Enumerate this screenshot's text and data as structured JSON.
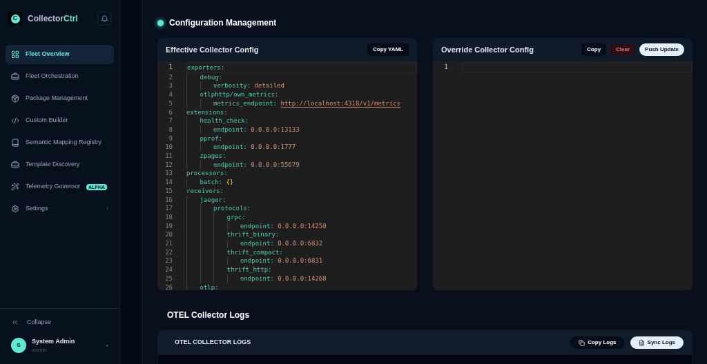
{
  "brand": {
    "name": "Collector",
    "name_accent": "Ctrl",
    "logo_letter": "C"
  },
  "sidebar": {
    "items": [
      {
        "label": "Fleet Overview",
        "selected": true
      },
      {
        "label": "Fleet Orchestration",
        "selected": false
      },
      {
        "label": "Package Management",
        "selected": false
      },
      {
        "label": "Custom Builder",
        "selected": false
      },
      {
        "label": "Semantic Mapping Registry",
        "selected": false
      },
      {
        "label": "Template Discovery",
        "selected": false
      },
      {
        "label": "Telemetry Governor",
        "selected": false,
        "badge": "ALPHA"
      },
      {
        "label": "Settings",
        "selected": false,
        "chevron": "›"
      }
    ],
    "collapse": "Collapse",
    "user": {
      "initial": "S",
      "name": "System Admin",
      "role": "admin",
      "caret": "▾"
    }
  },
  "page_title": "Configuration Management",
  "effective_config": {
    "title": "Effective Collector Config",
    "buttons": [
      {
        "label": "Copy YAML",
        "kind": "dark"
      }
    ],
    "lines": [
      {
        "number": "1",
        "key": "exporters:",
        "children": [
          {
            "number": "2",
            "key": "debug:",
            "children": [
              {
                "number": "3",
                "key": "verbosity:",
                "value": "detailed",
                "kind": "string"
              }
            ]
          },
          {
            "number": "4",
            "key": "otlphttp/own_metrics:",
            "children": [
              {
                "number": "5",
                "key": "metrics_endpoint:",
                "value": "http://localhost:4318/v1/metrics",
                "kind": "link"
              }
            ]
          }
        ]
      },
      {
        "number": "6",
        "key": "extensions:",
        "children": [
          {
            "number": "7",
            "key": "health_check:",
            "children": [
              {
                "number": "8",
                "key": "endpoint:",
                "value": "0.0.0.0:13133",
                "kind": "string"
              }
            ]
          },
          {
            "number": "9",
            "key": "pprof:",
            "children": [
              {
                "number": "10",
                "key": "endpoint:",
                "value": "0.0.0.0:1777",
                "kind": "string"
              }
            ]
          },
          {
            "number": "11",
            "key": "zpages:",
            "children": [
              {
                "number": "12",
                "key": "endpoint:",
                "value": "0.0.0.0:55679",
                "kind": "string"
              }
            ]
          }
        ]
      },
      {
        "number": "13",
        "key": "processors:",
        "children": [
          {
            "number": "14",
            "key": "batch:",
            "value": "{}",
            "kind": "braces"
          }
        ]
      },
      {
        "number": "15",
        "key": "receivers:",
        "children": [
          {
            "number": "16",
            "key": "jaeger:",
            "children": [
              {
                "number": "17",
                "key": "protocols:",
                "children": [
                  {
                    "number": "18",
                    "key": "grpc:",
                    "children": [
                      {
                        "number": "19",
                        "key": "endpoint:",
                        "value": "0.0.0.0:14250",
                        "kind": "string"
                      }
                    ]
                  },
                  {
                    "number": "20",
                    "key": "thrift_binary:",
                    "children": [
                      {
                        "number": "21",
                        "key": "endpoint:",
                        "value": "0.0.0.0:6832",
                        "kind": "string"
                      }
                    ]
                  },
                  {
                    "number": "22",
                    "key": "thrift_compact:",
                    "children": [
                      {
                        "number": "23",
                        "key": "endpoint:",
                        "value": "0.0.0.0:6831",
                        "kind": "string"
                      }
                    ]
                  },
                  {
                    "number": "24",
                    "key": "thrift_http:",
                    "children": [
                      {
                        "number": "25",
                        "key": "endpoint:",
                        "value": "0.0.0.0:14268",
                        "kind": "string"
                      }
                    ]
                  }
                ]
              }
            ]
          },
          {
            "number": "26",
            "key": "otlp:"
          }
        ]
      }
    ]
  },
  "override_config": {
    "title": "Override Collector Config",
    "buttons": [
      {
        "label": "Copy",
        "kind": "dark"
      },
      {
        "label": "Clear",
        "kind": "danger"
      },
      {
        "label": "Push Update",
        "kind": "light"
      }
    ],
    "lines": [
      {
        "number": "1"
      }
    ]
  },
  "logs_section": {
    "title": "OTEL Collector Logs",
    "card_title": "OTEL COLLECTOR LOGS",
    "buttons": [
      {
        "label": "Copy Logs",
        "kind": "dark"
      },
      {
        "label": "Sync Logs",
        "kind": "light"
      }
    ]
  }
}
